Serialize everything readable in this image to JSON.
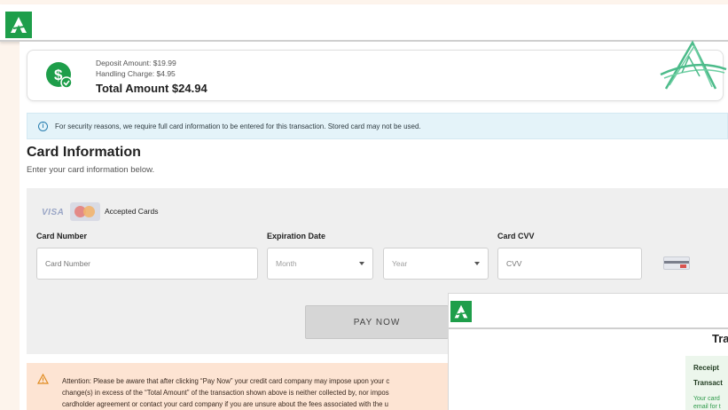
{
  "colors": {
    "brand": "#1e9e4a",
    "alert_bg": "#e4f3f9",
    "attention_bg": "#fde4d3",
    "panel_bg": "#efefef"
  },
  "amount": {
    "deposit": "Deposit Amount: $19.99",
    "handling": "Handling Charge: $4.95",
    "total": "Total Amount $24.94",
    "icon": "dollar-check-icon"
  },
  "security_alert": "For security reasons, we require full card information to be entered for this transaction. Stored card may not be used.",
  "card_section": {
    "title": "Card Information",
    "subtitle": "Enter your card information below.",
    "visa": "VISA",
    "accepted": "Accepted Cards",
    "card_number_label": "Card Number",
    "card_number_placeholder": "Card Number",
    "expiration_label": "Expiration Date",
    "month_placeholder": "Month",
    "year_placeholder": "Year",
    "cvv_label": "Card CVV",
    "cvv_placeholder": "CVV",
    "pay_button": "PAY NOW"
  },
  "attention": {
    "line1": "Attention: Please be aware that after clicking “Pay Now” your credit card company may impose upon your c",
    "line2": "change(s) in excess of the “Total Amount” of the transaction shown above is neither collected by, nor impos",
    "line3": "cardholder agreement or contact your card company if you are unsure about the fees associated with the u"
  },
  "overlay": {
    "title": "Tra",
    "receipt": "Receipt",
    "transaction": "Transact",
    "note_line1": "Your card",
    "note_line2": "email for t"
  }
}
